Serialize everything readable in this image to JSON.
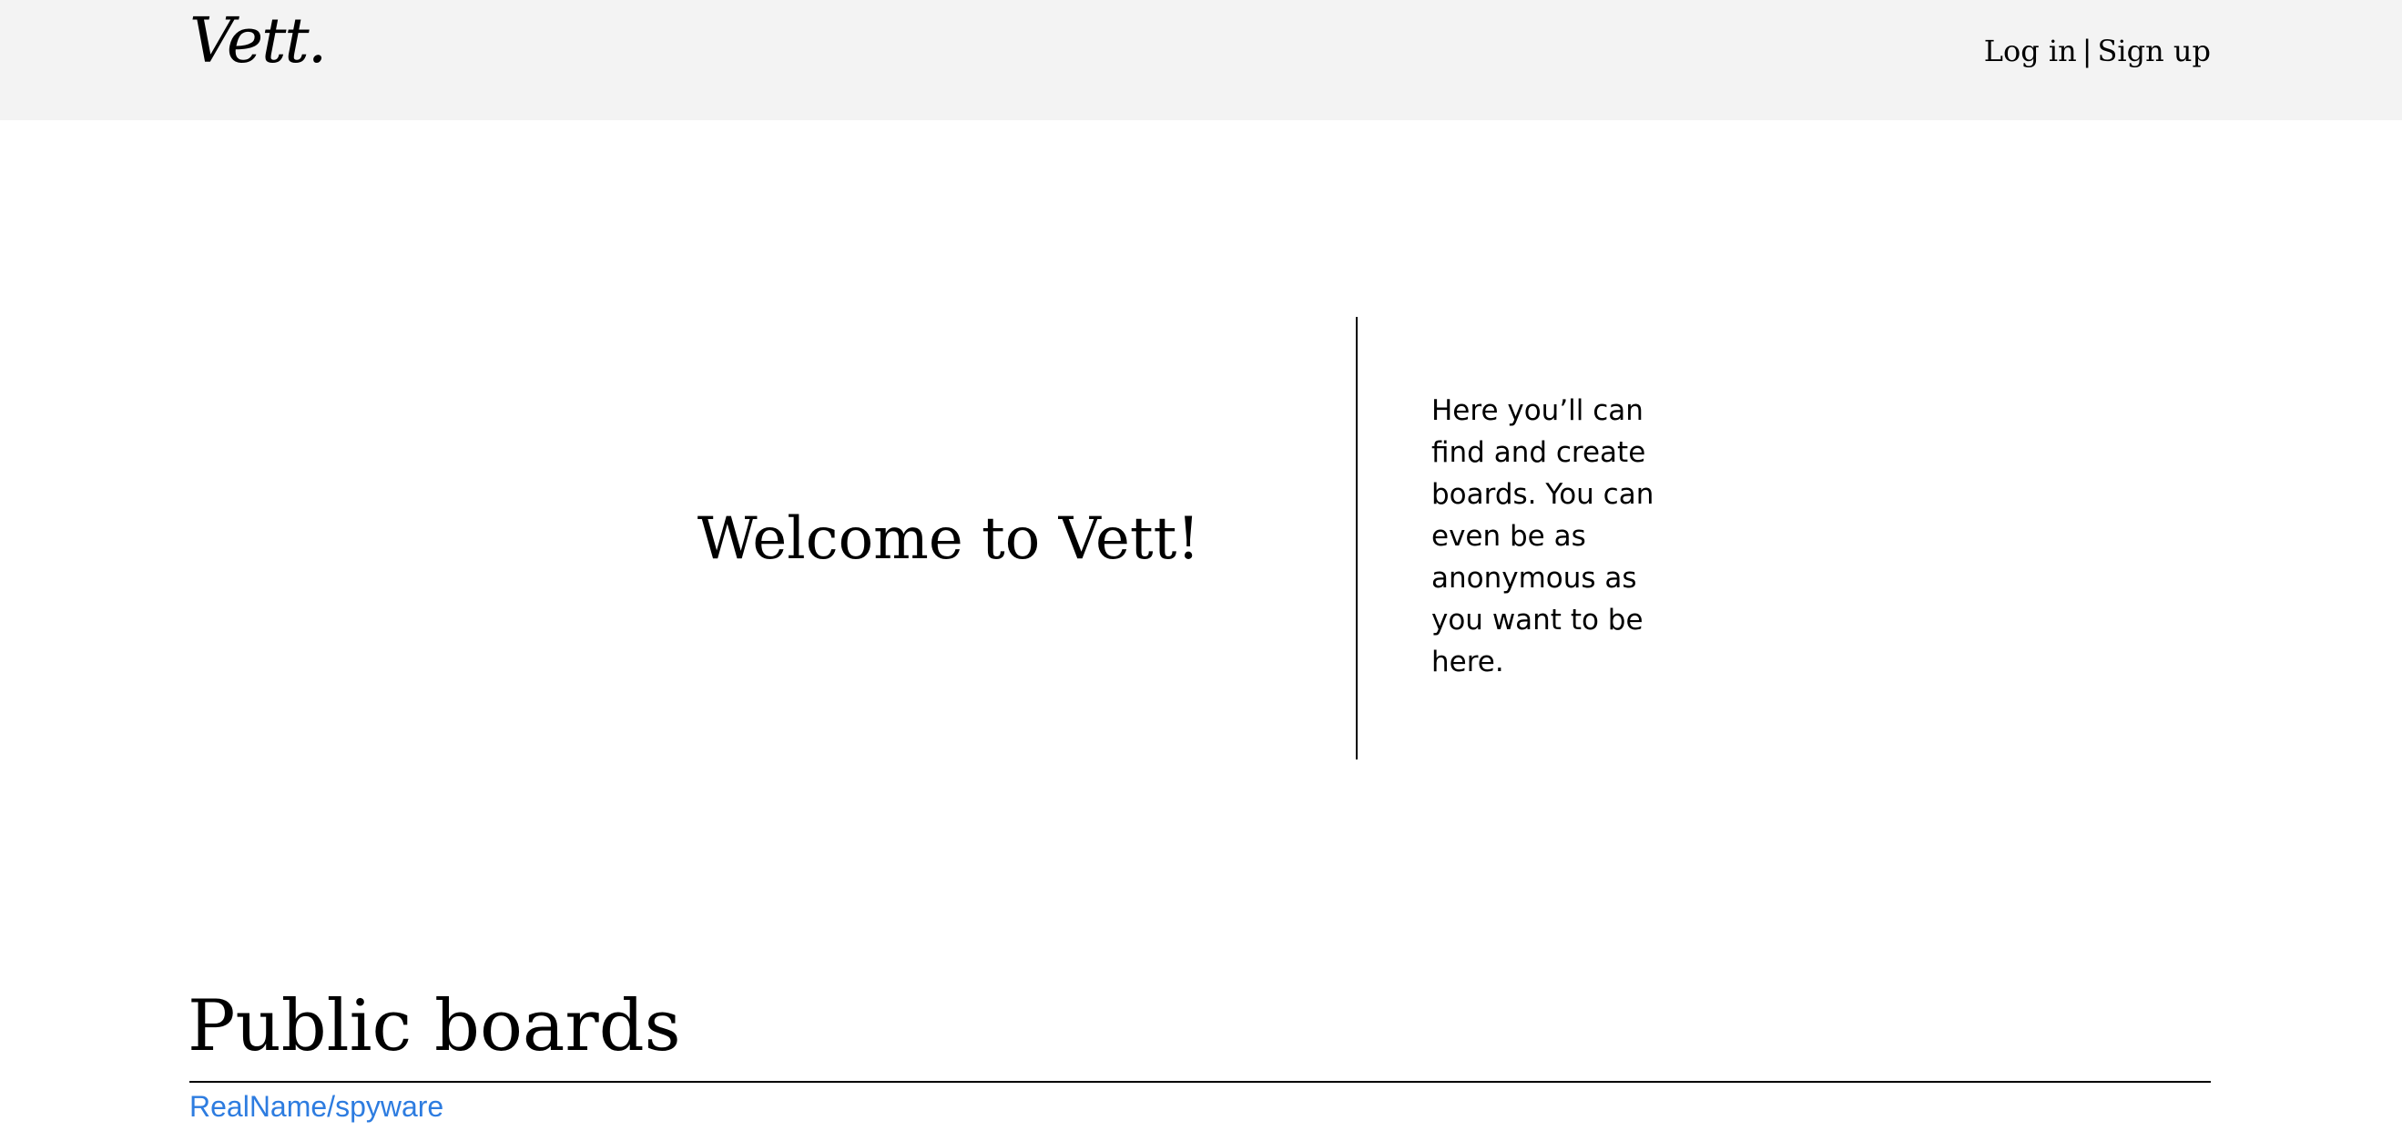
{
  "header": {
    "logo": "Vett.",
    "login_label": "Log in",
    "separator": "|",
    "signup_label": "Sign up"
  },
  "hero": {
    "title": "Welcome to Vett!",
    "description": "Here you’ll can find and create boards. You can even be as anonymous as you want to be here."
  },
  "public_boards": {
    "title": "Public boards",
    "items": [
      {
        "label": "RealName/spyware"
      }
    ]
  },
  "colors": {
    "header_background": "#f3f3f3",
    "link": "#2d7ce0",
    "text": "#000000"
  }
}
